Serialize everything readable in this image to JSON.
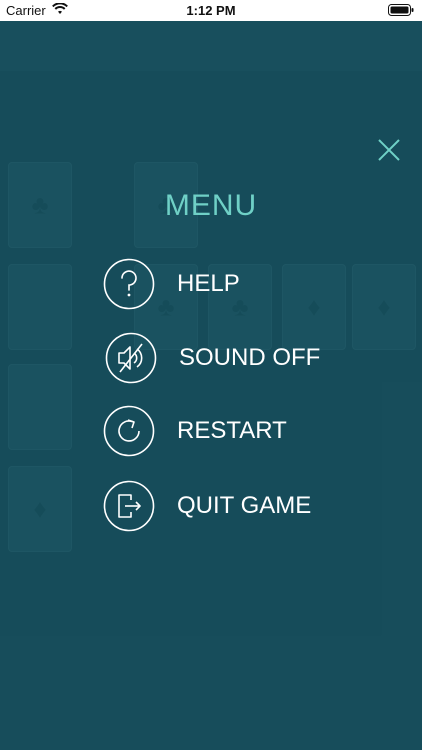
{
  "status_bar": {
    "carrier": "Carrier",
    "time": "1:12 PM"
  },
  "menu": {
    "title": "MENU",
    "items": [
      {
        "label": "HELP",
        "icon": "help-icon"
      },
      {
        "label": "SOUND OFF",
        "icon": "sound-off-icon"
      },
      {
        "label": "RESTART",
        "icon": "restart-icon"
      },
      {
        "label": "QUIT GAME",
        "icon": "quit-icon"
      }
    ]
  },
  "colors": {
    "background": "#1f5563",
    "accent": "#6fd0c6",
    "text": "#ffffff"
  }
}
